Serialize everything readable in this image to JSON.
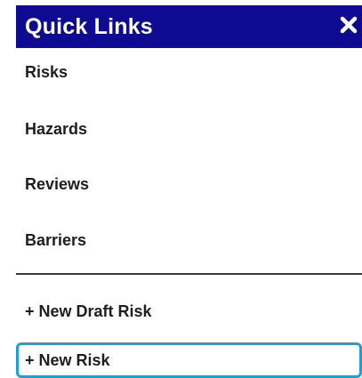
{
  "panel": {
    "title": "Quick Links",
    "close_icon": "close-icon",
    "header_color": "#0f0a92",
    "focus_color": "#1f9fd6"
  },
  "links": [
    {
      "label": "Risks"
    },
    {
      "label": "Hazards"
    },
    {
      "label": "Reviews"
    },
    {
      "label": "Barriers"
    }
  ],
  "actions": [
    {
      "label": "+ New Draft Risk",
      "focused": false
    },
    {
      "label": "+ New Risk",
      "focused": true
    }
  ]
}
